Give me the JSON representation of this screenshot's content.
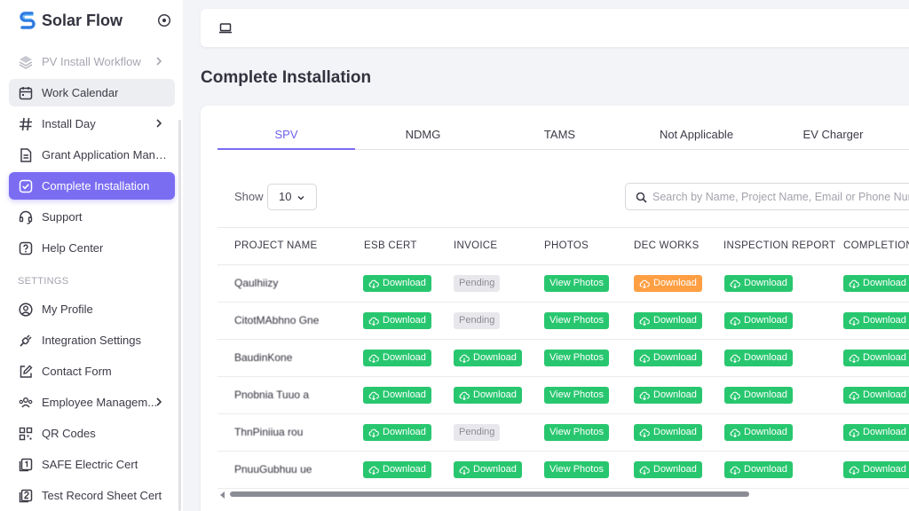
{
  "app": {
    "name": "Solar Flow"
  },
  "sidebar": {
    "items": [
      {
        "label": "PV Install Workflow",
        "icon": "layers-icon",
        "chevron": true
      },
      {
        "label": "Work Calendar",
        "icon": "calendar-icon"
      },
      {
        "label": "Install Day",
        "icon": "hash-icon",
        "chevron": true
      },
      {
        "label": "Grant Application Mana...",
        "icon": "document-icon"
      },
      {
        "label": "Complete Installation",
        "icon": "check-square-icon"
      },
      {
        "label": "Support",
        "icon": "headset-icon"
      },
      {
        "label": "Help Center",
        "icon": "question-icon"
      }
    ],
    "settings_label": "SETTINGS",
    "settings_items": [
      {
        "label": "My Profile",
        "icon": "user-circle-icon"
      },
      {
        "label": "Integration Settings",
        "icon": "plug-icon"
      },
      {
        "label": "Contact Form",
        "icon": "edit-form-icon"
      },
      {
        "label": "Employee Managem...",
        "icon": "users-icon",
        "chevron": true
      },
      {
        "label": "QR Codes",
        "icon": "qr-code-icon"
      },
      {
        "label": "SAFE Electric Cert",
        "icon": "certificate-icon"
      },
      {
        "label": "Test Record Sheet Cert",
        "icon": "certificate-icon"
      }
    ]
  },
  "page": {
    "title": "Complete Installation"
  },
  "tabs": [
    "SPV",
    "NDMG",
    "TAMS",
    "Not Applicable",
    "EV Charger"
  ],
  "controls": {
    "show_label": "Show",
    "show_value": "10",
    "search_placeholder": "Search by Name, Project Name, Email or Phone Number"
  },
  "table": {
    "columns": [
      "PROJECT NAME",
      "ESB CERT",
      "INVOICE",
      "PHOTOS",
      "DEC WORKS",
      "INSPECTION REPORT",
      "COMPLETION C"
    ],
    "rows": [
      {
        "name": "Qaulhiizy",
        "esb": "Download",
        "invoice": "Pending",
        "photos": "View Photos",
        "dec": "Download",
        "inspection": "Download",
        "completion": "Download"
      },
      {
        "name": "CitotMAbhno Gne",
        "esb": "Download",
        "invoice": "Pending",
        "photos": "View Photos",
        "dec": "Download",
        "inspection": "Download",
        "completion": "Download"
      },
      {
        "name": "BaudinKone",
        "esb": "Download",
        "invoice": "Download",
        "photos": "View Photos",
        "dec": "Download",
        "inspection": "Download",
        "completion": "Download"
      },
      {
        "name": "Pnobnia Tuuo a",
        "esb": "Download",
        "invoice": "Download",
        "photos": "View Photos",
        "dec": "Download",
        "inspection": "Download",
        "completion": "Download"
      },
      {
        "name": "ThnPiniiua rou",
        "esb": "Download",
        "invoice": "Pending",
        "photos": "View Photos",
        "dec": "Download",
        "inspection": "Download",
        "completion": "Download"
      },
      {
        "name": "PnuuGubhuu ue",
        "esb": "Download",
        "invoice": "Download",
        "photos": "View Photos",
        "dec": "Download",
        "inspection": "Download",
        "completion": "Download"
      }
    ]
  },
  "colors": {
    "accent": "#7a6df2",
    "success": "#28c76f",
    "warning": "#ff9f43",
    "pending": "#e8e8ec"
  }
}
